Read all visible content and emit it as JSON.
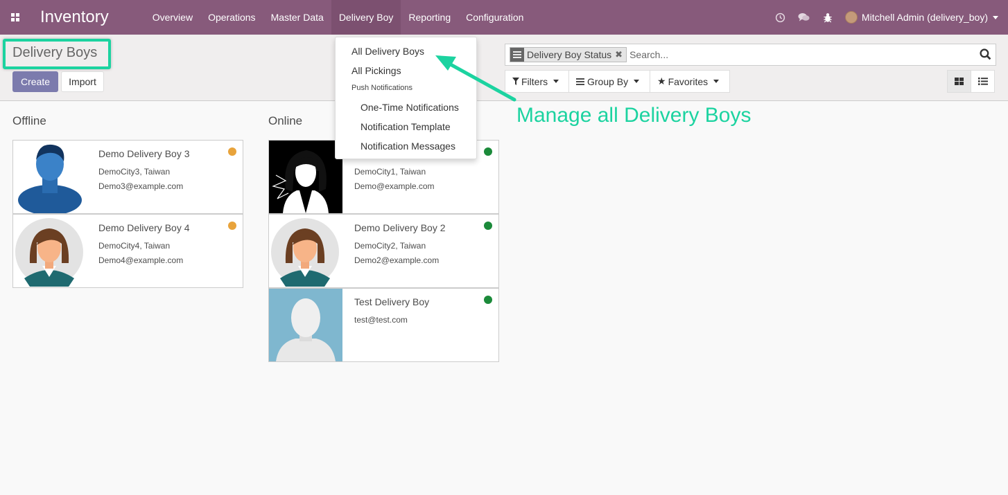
{
  "navbar": {
    "app_name": "Inventory",
    "menu": [
      "Overview",
      "Operations",
      "Master Data",
      "Delivery Boy",
      "Reporting",
      "Configuration"
    ],
    "active_menu": "Delivery Boy",
    "icons": [
      "clock-icon",
      "chat-icon",
      "bug-icon"
    ],
    "user": "Mitchell Admin (delivery_boy)"
  },
  "control_panel": {
    "title": "Delivery Boys",
    "create_label": "Create",
    "import_label": "Import",
    "search": {
      "facet": "Delivery Boy Status",
      "placeholder": "Search..."
    },
    "filters_label": "Filters",
    "group_by_label": "Group By",
    "favorites_label": "Favorites"
  },
  "dropdown": {
    "items": [
      "All Delivery Boys",
      "All Pickings"
    ],
    "header": "Push Notifications",
    "sub_items": [
      "One-Time Notifications",
      "Notification Template",
      "Notification Messages"
    ]
  },
  "annotation": {
    "text": "Manage all Delivery Boys",
    "color": "#1cd3a0"
  },
  "kanban": {
    "columns": [
      {
        "title": "Offline",
        "cards": [
          {
            "name": "Demo Delivery Boy 3",
            "address": "DemoCity3, Taiwan",
            "email": "Demo3@example.com",
            "status_color": "#f0ad4e",
            "avatar": "male-silhouette-avatar"
          },
          {
            "name": "Demo Delivery Boy 4",
            "address": "DemoCity4, Taiwan",
            "email": "Demo4@example.com",
            "status_color": "#f0ad4e",
            "avatar": "female-avatar"
          }
        ]
      },
      {
        "title": "Online",
        "cards": [
          {
            "name": "",
            "address": "DemoCity1, Taiwan",
            "email": "Demo@example.com",
            "status_color": "#1b8a3a",
            "avatar": "female-silhouette-avatar"
          },
          {
            "name": "Demo Delivery Boy 2",
            "address": "DemoCity2, Taiwan",
            "email": "Demo2@example.com",
            "status_color": "#1b8a3a",
            "avatar": "female-avatar"
          },
          {
            "name": "Test Delivery Boy",
            "address": "",
            "email": "test@test.com",
            "status_color": "#1b8a3a",
            "avatar": "placeholder-avatar"
          }
        ]
      }
    ]
  },
  "colors": {
    "navbar": "#875a7b",
    "primary_button": "#7c7bad",
    "highlight": "#1cd3a0"
  }
}
